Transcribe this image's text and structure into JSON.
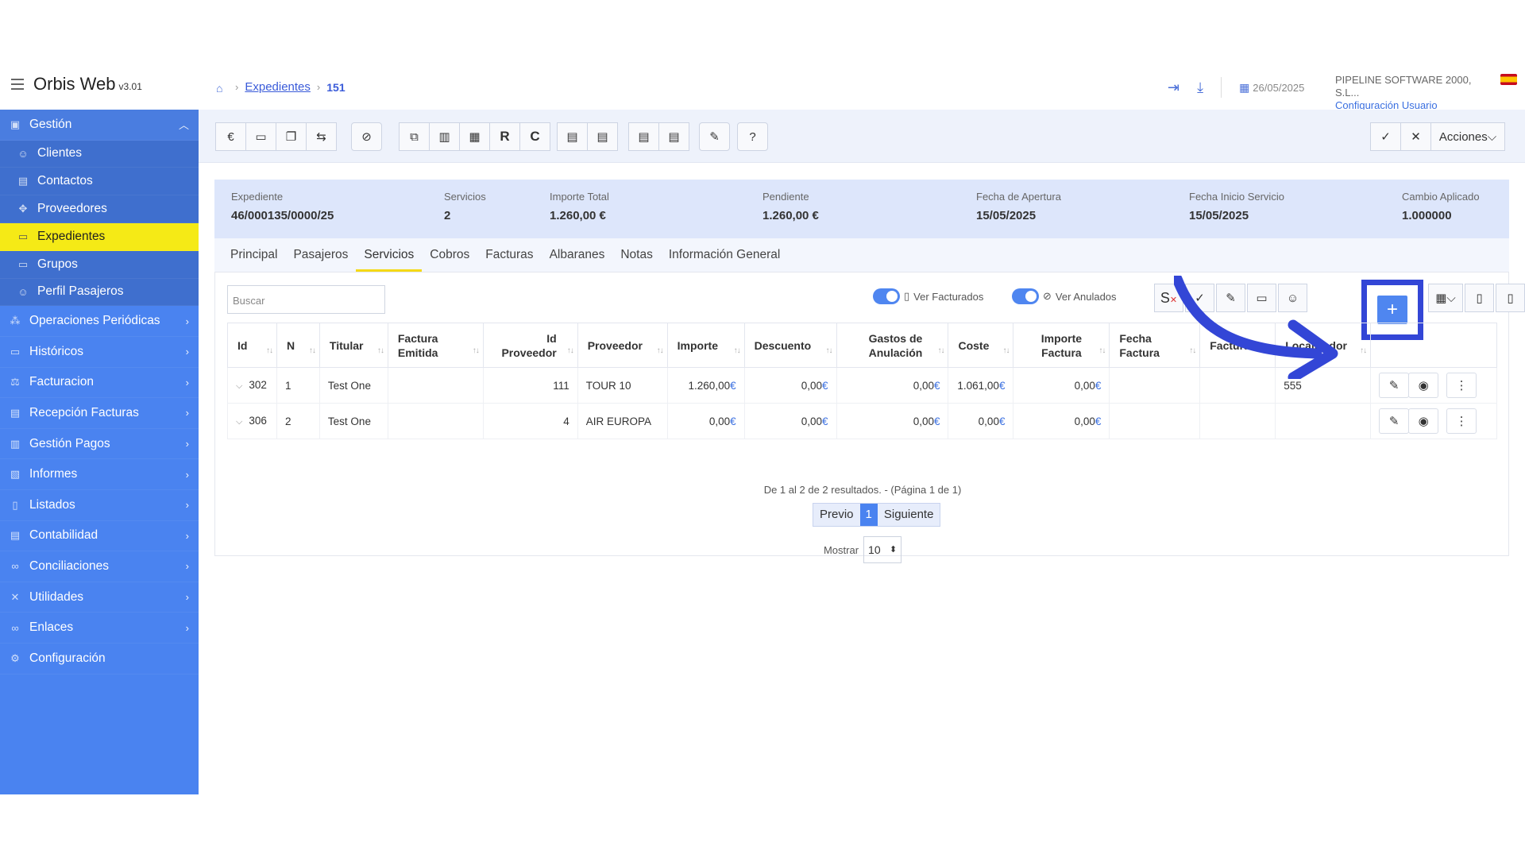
{
  "app": {
    "name": "Orbis Web",
    "version": "v3.01"
  },
  "breadcrumb": {
    "link": "Expedientes",
    "current": "151"
  },
  "header": {
    "date": "26/05/2025",
    "company": "PIPELINE SOFTWARE 2000, S.L...",
    "user_config": "Configuración Usuario"
  },
  "sidebar": {
    "gestion": "Gestión",
    "sub": [
      "Clientes",
      "Contactos",
      "Proveedores",
      "Expedientes",
      "Grupos",
      "Perfil Pasajeros"
    ],
    "sections": [
      "Operaciones Periódicas",
      "Históricos",
      "Facturacion",
      "Recepción Facturas",
      "Gestión Pagos",
      "Informes",
      "Listados",
      "Contabilidad",
      "Conciliaciones",
      "Utilidades",
      "Enlaces",
      "Configuración"
    ]
  },
  "toolbar": {
    "r": "R",
    "c": "C",
    "acciones": "Acciones"
  },
  "summary": {
    "expediente_l": "Expediente",
    "expediente_v": "46/000135/0000/25",
    "servicios_l": "Servicios",
    "servicios_v": "2",
    "importe_l": "Importe Total",
    "importe_v": "1.260,00 €",
    "pendiente_l": "Pendiente",
    "pendiente_v": "1.260,00 €",
    "apertura_l": "Fecha de Apertura",
    "apertura_v": "15/05/2025",
    "inicio_l": "Fecha Inicio Servicio",
    "inicio_v": "15/05/2025",
    "cambio_l": "Cambio Aplicado",
    "cambio_v": "1.000000"
  },
  "tabs": [
    "Principal",
    "Pasajeros",
    "Servicios",
    "Cobros",
    "Facturas",
    "Albaranes",
    "Notas",
    "Información General"
  ],
  "filters": {
    "search_placeholder": "Buscar",
    "ver_facturados": "Ver Facturados",
    "ver_anulados": "Ver Anulados"
  },
  "table": {
    "headers": [
      "Id",
      "N",
      "Titular",
      "Factura Emitida",
      "Id Proveedor",
      "Proveedor",
      "Importe",
      "Descuento",
      "Gastos de Anulación",
      "Coste",
      "Importe Factura",
      "Fecha Factura",
      "Factura",
      "Localizador"
    ],
    "rows": [
      {
        "id": "302",
        "n": "1",
        "titular": "Test One",
        "factura_emitida": "",
        "id_proveedor": "111",
        "proveedor": "TOUR 10",
        "importe": "1.260,00",
        "descuento": "0,00",
        "gastos": "0,00",
        "coste": "1.061,00",
        "importe_factura": "0,00",
        "fecha_factura": "",
        "factura": "",
        "localizador": "555"
      },
      {
        "id": "306",
        "n": "2",
        "titular": "Test One",
        "factura_emitida": "",
        "id_proveedor": "4",
        "proveedor": "AIR EUROPA",
        "importe": "0,00",
        "descuento": "0,00",
        "gastos": "0,00",
        "coste": "0,00",
        "importe_factura": "0,00",
        "fecha_factura": "",
        "factura": "",
        "localizador": ""
      }
    ],
    "currency": "€"
  },
  "pagination": {
    "results": "De 1 al 2 de 2 resultados. - (Página 1 de 1)",
    "prev": "Previo",
    "page": "1",
    "next": "Siguiente",
    "mostrar": "Mostrar",
    "page_size": "10"
  }
}
